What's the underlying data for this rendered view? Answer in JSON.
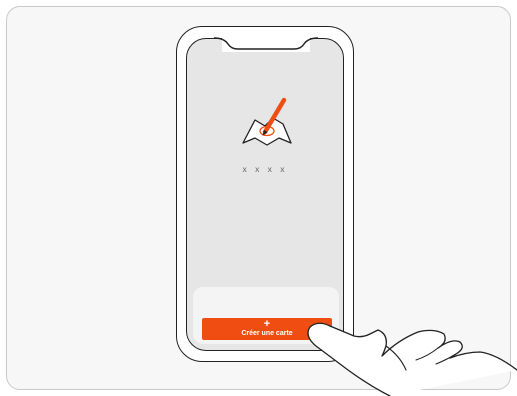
{
  "screen": {
    "card_placeholder": "x x x x",
    "create_button": {
      "plus": "+",
      "label": "Créer une carte"
    }
  },
  "icons": {
    "app_icon": "map-pencil-icon",
    "hand": "tapping-hand-icon"
  },
  "colors": {
    "accent": "#f04d12",
    "screen_bg": "#e6e6e6",
    "outline": "#222222"
  }
}
